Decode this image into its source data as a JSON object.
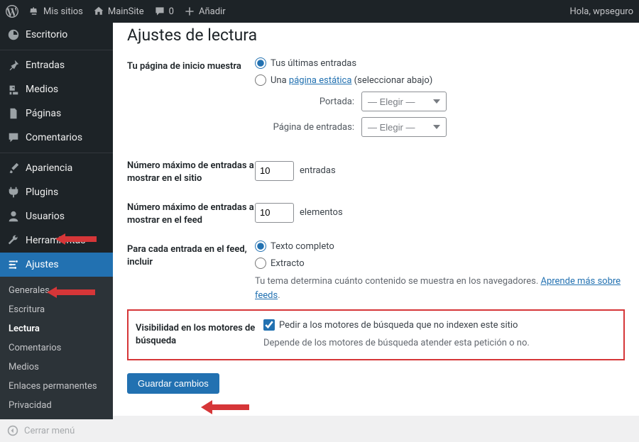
{
  "adminbar": {
    "mysites": "Mis sitios",
    "sitename": "MainSite",
    "comments": "0",
    "add": "Añadir",
    "greeting": "Hola, wpseguro"
  },
  "sidebar": {
    "items": [
      {
        "label": "Escritorio"
      },
      {
        "label": "Entradas"
      },
      {
        "label": "Medios"
      },
      {
        "label": "Páginas"
      },
      {
        "label": "Comentarios"
      },
      {
        "label": "Apariencia"
      },
      {
        "label": "Plugins"
      },
      {
        "label": "Usuarios"
      },
      {
        "label": "Herramientas"
      },
      {
        "label": "Ajustes"
      }
    ],
    "submenu": [
      {
        "label": "Generales"
      },
      {
        "label": "Escritura"
      },
      {
        "label": "Lectura"
      },
      {
        "label": "Comentarios"
      },
      {
        "label": "Medios"
      },
      {
        "label": "Enlaces permanentes"
      },
      {
        "label": "Privacidad"
      }
    ],
    "collapse": "Cerrar menú"
  },
  "page": {
    "title": "Ajustes de lectura",
    "homepage": {
      "label": "Tu página de inicio muestra",
      "opt_latest": "Tus últimas entradas",
      "opt_static_prefix": "Una ",
      "opt_static_link": "página estática",
      "opt_static_suffix": " (seleccionar abajo)",
      "front_label": "Portada:",
      "posts_label": "Página de entradas:",
      "select_placeholder": "— Elegir —"
    },
    "posts_per_page": {
      "label": "Número máximo de entradas a mostrar en el sitio",
      "value": "10",
      "unit": "entradas"
    },
    "posts_per_feed": {
      "label": "Número máximo de entradas a mostrar en el feed",
      "value": "10",
      "unit": "elementos"
    },
    "feed_content": {
      "label": "Para cada entrada en el feed, incluir",
      "opt_full": "Texto completo",
      "opt_excerpt": "Extracto",
      "desc_prefix": "Tu tema determina cuánto contenido se muestra en los navegadores. ",
      "desc_link": "Aprende más sobre feeds",
      "desc_suffix": "."
    },
    "visibility": {
      "label": "Visibilidad en los motores de búsqueda",
      "check_label": "Pedir a los motores de búsqueda que no indexen este sitio",
      "desc": "Depende de los motores de búsqueda atender esta petición o no."
    },
    "save": "Guardar cambios"
  }
}
